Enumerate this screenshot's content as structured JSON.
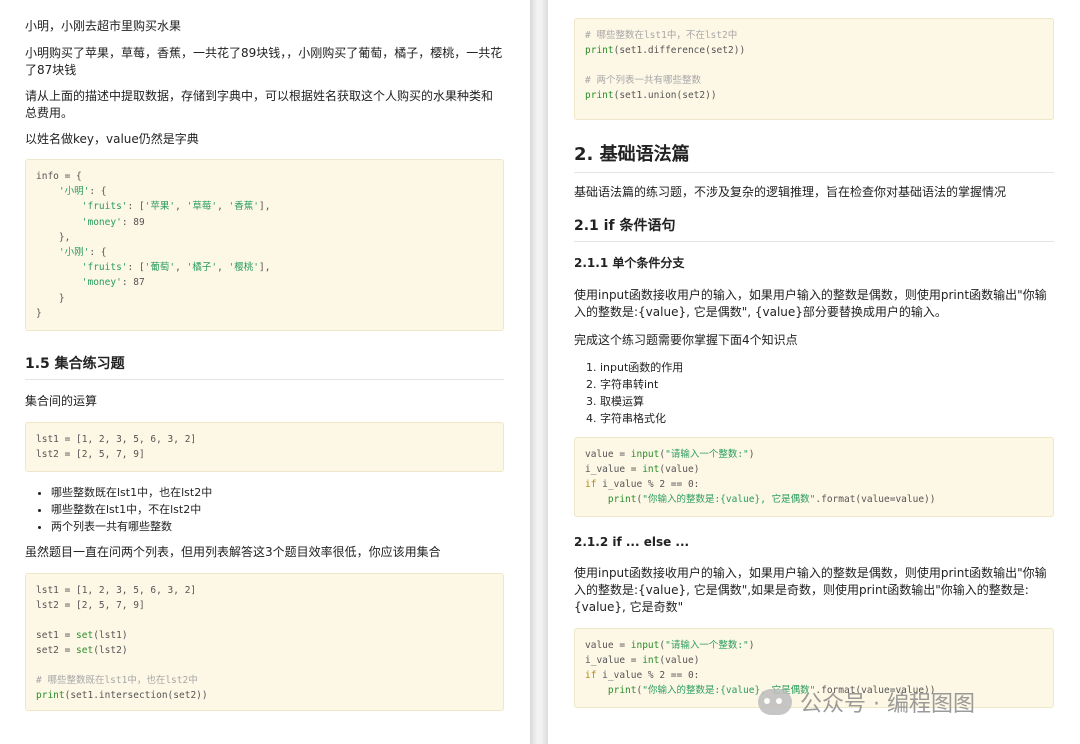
{
  "left": {
    "p1": "小明，小刚去超市里购买水果",
    "p2": "小明购买了苹果，草莓，香蕉，一共花了89块钱，，小刚购买了葡萄，橘子，樱桃，一共花了87块钱",
    "p3": "请从上面的描述中提取数据，存储到字典中，可以根据姓名获取这个人购买的水果种类和总费用。",
    "p4": "以姓名做key，value仍然是字典",
    "code1": "info = {\n    '小明': {\n        'fruits': ['苹果', '草莓', '香蕉'],\n        'money': 89\n    },\n    '小刚': {\n        'fruits': ['葡萄', '橘子', '樱桃'],\n        'money': 87\n    }\n}",
    "h_sets": "1.5 集合练习题",
    "p_sets": "集合间的运算",
    "code2": "lst1 = [1, 2, 3, 5, 6, 3, 2]\nlst2 = [2, 5, 7, 9]",
    "bullets": [
      "哪些整数既在lst1中，也在lst2中",
      "哪些整数在lst1中，不在lst2中",
      "两个列表一共有哪些整数"
    ],
    "p_note": "虽然题目一直在问两个列表，但用列表解答这3个题目效率很低，你应该用集合",
    "code3": "lst1 = [1, 2, 3, 5, 6, 3, 2]\nlst2 = [2, 5, 7, 9]\n\nset1 = set(lst1)\nset2 = set(lst2)\n\n# 哪些整数既在lst1中，也在lst2中\nprint(set1.intersection(set2))"
  },
  "right": {
    "code_top": "# 哪些整数在lst1中，不在lst2中\nprint(set1.difference(set2))\n\n# 两个列表一共有哪些整数\nprint(set1.union(set2))",
    "h2": "2. 基础语法篇",
    "p_intro": "基础语法篇的练习题，不涉及复杂的逻辑推理，旨在检查你对基础语法的掌握情况",
    "h3": "2.1 if 条件语句",
    "h4_1": "2.1.1 单个条件分支",
    "p_211": "使用input函数接收用户的输入，如果用户输入的整数是偶数，则使用print函数输出\"你输入的整数是:{value}, 它是偶数\", {value}部分要替换成用户的输入。",
    "p_need": "完成这个练习题需要你掌握下面4个知识点",
    "ol": [
      "input函数的作用",
      "字符串转int",
      "取模运算",
      "字符串格式化"
    ],
    "code4": "value = input(\"请输入一个整数:\")\ni_value = int(value)\nif i_value % 2 == 0:\n    print(\"你输入的整数是:{value}, 它是偶数\".format(value=value))",
    "h4_2": "2.1.2 if ... else ...",
    "p_212": "使用input函数接收用户的输入，如果用户输入的整数是偶数，则使用print函数输出\"你输入的整数是:{value}, 它是偶数\",如果是奇数，则使用print函数输出\"你输入的整数是:{value}, 它是奇数\"",
    "code5": "value = input(\"请输入一个整数:\")\ni_value = int(value)\nif i_value % 2 == 0:\n    print(\"你输入的整数是:{value}, 它是偶数\".format(value=value))"
  },
  "watermark": "公众号 · 编程图图"
}
